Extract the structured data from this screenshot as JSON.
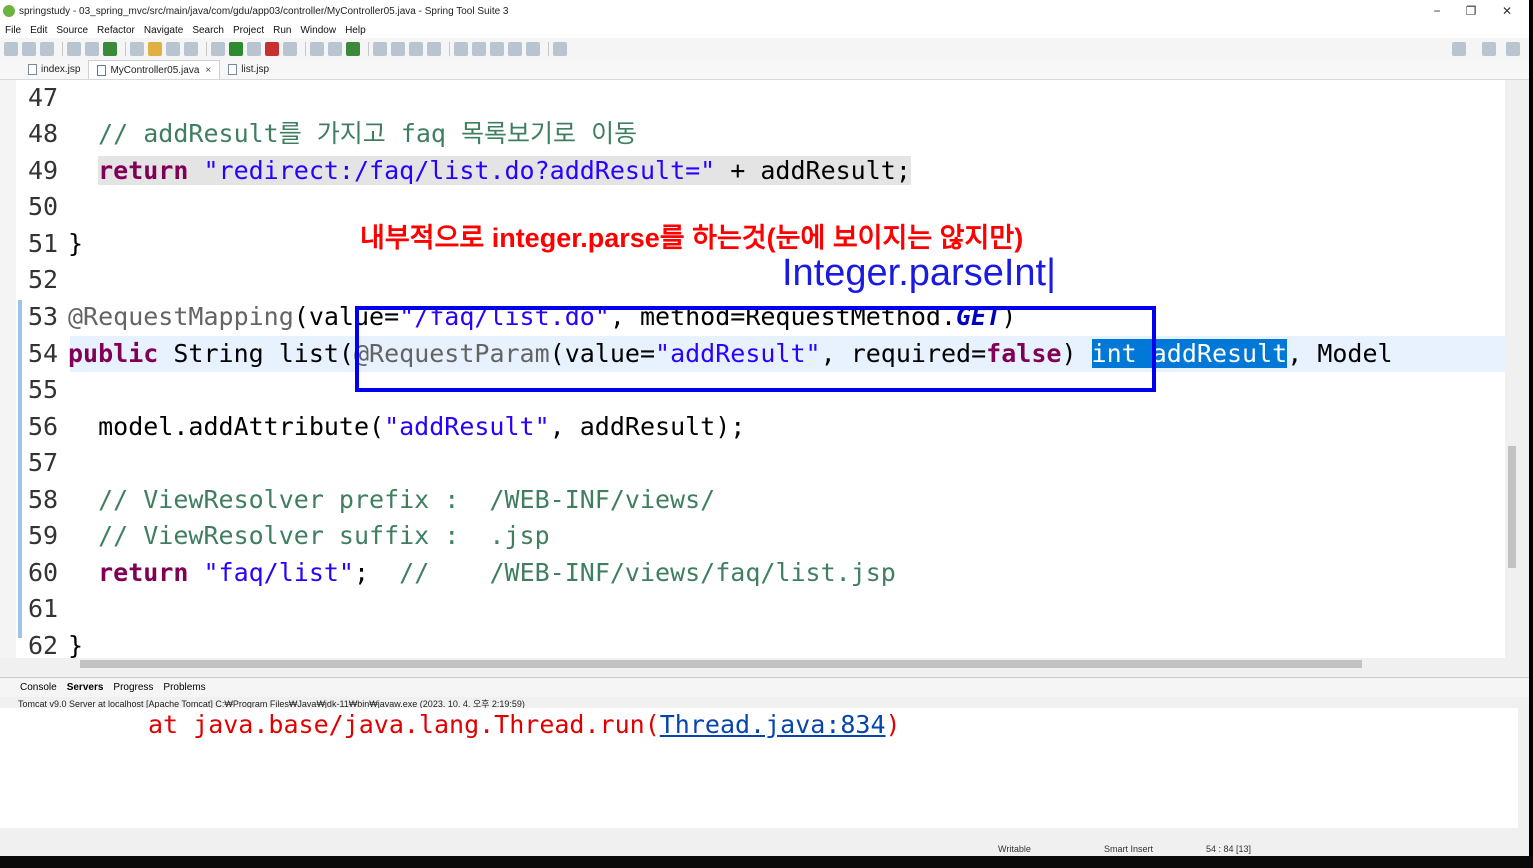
{
  "window": {
    "title": "springstudy - 03_spring_mvc/src/main/java/com/gdu/app03/controller/MyController05.java - Spring Tool Suite 3",
    "controls": [
      "−",
      "❐",
      "✕"
    ]
  },
  "menu": [
    "File",
    "Edit",
    "Source",
    "Refactor",
    "Navigate",
    "Search",
    "Project",
    "Run",
    "Window",
    "Help"
  ],
  "tabs": [
    {
      "label": "index.jsp",
      "active": false
    },
    {
      "label": "MyController05.java",
      "active": true
    },
    {
      "label": "list.jsp",
      "active": false
    }
  ],
  "code": {
    "lines": [
      {
        "n": "47"
      },
      {
        "n": "48",
        "t": "  // addResult를 가지고 faq 목록보기로 이동"
      },
      {
        "n": "49",
        "t1": "  ",
        "kw": "return",
        "s": " \"redirect:/faq/list.do?addResult=\"",
        "t2": " + addResult;"
      },
      {
        "n": "50"
      },
      {
        "n": "51",
        "t": "}"
      },
      {
        "n": "52"
      },
      {
        "n": "53",
        "a": "@RequestMapping",
        "t1": "(value=",
        "s": "\"/faq/list.do\"",
        "t2": ", method=RequestMethod.",
        "i": "GET",
        "t3": ")"
      },
      {
        "n": "54",
        "kw1": "public",
        "t1": " String list(",
        "a": "@RequestParam",
        "t2": "(value=",
        "s": "\"addResult\"",
        "t3": ", required=",
        "kw2": "false",
        "t4": ") ",
        "sel": "int addResult",
        "t5": ", Model"
      },
      {
        "n": "55"
      },
      {
        "n": "56",
        "t1": "  model.addAttribute(",
        "s": "\"addResult\"",
        "t2": ", addResult);"
      },
      {
        "n": "57"
      },
      {
        "n": "58",
        "t": "  // ViewResolver prefix :  /WEB-INF/views/"
      },
      {
        "n": "59",
        "t": "  // ViewResolver suffix :  .jsp"
      },
      {
        "n": "60",
        "t1": "  ",
        "kw": "return",
        "s": " \"faq/list\"",
        "t2": ";  ",
        "c": "//    /WEB-INF/views/faq/list.jsp"
      },
      {
        "n": "61"
      },
      {
        "n": "62",
        "t": "}"
      }
    ]
  },
  "annotations": {
    "red_note": "내부적으로 integer.parse를 하는것(눈에 보이지는 않지만)",
    "blue_note": "Integer.parseInt|"
  },
  "console": {
    "tabs": [
      "Console",
      "Servers",
      "Progress",
      "Problems"
    ],
    "status": "Tomcat v9.0 Server at localhost [Apache Tomcat] C:₩Program Files₩Java₩jdk-11₩bin₩javaw.exe  (2023. 10. 4. 오후 2:19:59)",
    "error_prefix": "at java.base/java.lang.Thread.run(",
    "error_link": "Thread.java:834",
    "error_suffix": ")"
  },
  "status": {
    "writable": "Writable",
    "insert": "Smart Insert",
    "position": "54 : 84 [13]"
  }
}
